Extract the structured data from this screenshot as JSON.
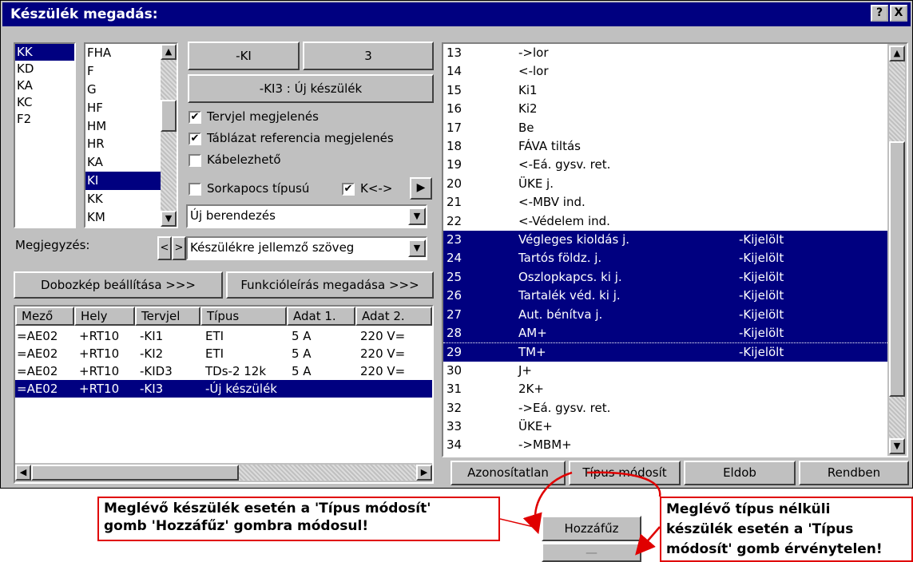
{
  "window": {
    "title": "Készülék megadás:",
    "help_label": "?",
    "close_label": "X"
  },
  "left_list": {
    "items": [
      "KK",
      "KD",
      "KA",
      "KC",
      "F2"
    ],
    "selected": 0
  },
  "second_list": {
    "items": [
      "FHA",
      "F",
      "G",
      "HF",
      "HM",
      "HR",
      "KA",
      "KI",
      "KK",
      "KM"
    ],
    "selected": 7
  },
  "id_buttons": {
    "prefix": "-KI",
    "number": "3",
    "full": "-KI3  :  Új készülék"
  },
  "checks": {
    "tervjel": {
      "label": "Tervjel megjelenés",
      "checked": true
    },
    "tablazat": {
      "label": "Táblázat referencia megjelenés",
      "checked": true
    },
    "kabel": {
      "label": "Kábelezhető",
      "checked": false
    },
    "sorkapocs": {
      "label": "Sorkapocs típusú",
      "checked": false
    },
    "k": {
      "label": "K<->",
      "checked": true
    }
  },
  "combo_berendezes": {
    "value": "Új berendezés"
  },
  "megjegyzes": {
    "label": "Megjegyzés:",
    "value": "Készülékre jellemző szöveg",
    "prev": "<",
    "next": ">"
  },
  "buttons": {
    "dobozkep": "Dobozkép beállítása >>>",
    "funkcio": "Funkcióleírás megadása >>>",
    "azonositatlan": "Azonosítatlan",
    "tipus": "Típus módosít",
    "eldob": "Eldob",
    "rendben": "Rendben",
    "hozzafuz": "Hozzáfűz",
    "disabled": "—"
  },
  "table": {
    "columns": [
      "Mező",
      "Hely",
      "Tervjel",
      "Típus",
      "Adat 1.",
      "Adat 2."
    ],
    "rows": [
      [
        "=AE02",
        "+RT10",
        "-KI1",
        "ETI",
        "5 A",
        "220 V="
      ],
      [
        "=AE02",
        "+RT10",
        "-KI2",
        "ETI",
        "5 A",
        "220 V="
      ],
      [
        "=AE02",
        "+RT10",
        "-KID3",
        "TDs-2 12k",
        "5 A",
        "220 V="
      ],
      [
        "=AE02",
        "+RT10",
        "-KI3",
        "-Új készülék",
        "",
        ""
      ]
    ],
    "selected": 3
  },
  "right_list": {
    "rows": [
      [
        "13",
        "->lor",
        ""
      ],
      [
        "14",
        "<-lor",
        ""
      ],
      [
        "15",
        "Ki1",
        ""
      ],
      [
        "16",
        "Ki2",
        ""
      ],
      [
        "17",
        "Be",
        ""
      ],
      [
        "18",
        "FÁVA tiltás",
        ""
      ],
      [
        "19",
        "<-Eá. gysv. ret.",
        ""
      ],
      [
        "20",
        "ÜKE j.",
        ""
      ],
      [
        "21",
        "<-MBV ind.",
        ""
      ],
      [
        "22",
        "<-Védelem ind.",
        ""
      ],
      [
        "23",
        "Végleges kioldás j.",
        "-Kijelölt"
      ],
      [
        "24",
        "Tartós földz. j.",
        "-Kijelölt"
      ],
      [
        "25",
        "Oszlopkapcs. ki j.",
        "-Kijelölt"
      ],
      [
        "26",
        "Tartalék véd. ki j.",
        "-Kijelölt"
      ],
      [
        "27",
        "Aut. bénítva j.",
        "-Kijelölt"
      ],
      [
        "28",
        "AM+",
        "-Kijelölt"
      ],
      [
        "29",
        "TM+",
        "-Kijelölt"
      ],
      [
        "30",
        "J+",
        ""
      ],
      [
        "31",
        "2K+",
        ""
      ],
      [
        "32",
        "->Eá. gysv. ret.",
        ""
      ],
      [
        "33",
        "ÜKE+",
        ""
      ],
      [
        "34",
        "->MBM+",
        ""
      ]
    ],
    "selected_from": 10,
    "selected_to": 16
  },
  "notes": {
    "left": [
      "Meglévő készülék esetén a 'Típus módosít'",
      "gomb 'Hozzáfűz' gombra módosul!"
    ],
    "right": [
      "Meglévő típus nélküli",
      "készülék esetén a 'Típus",
      "módosít' gomb érvénytelen!"
    ]
  },
  "colors": {
    "selection": "#000080",
    "annotation": "#e00000",
    "face": "#c0c0c0"
  }
}
